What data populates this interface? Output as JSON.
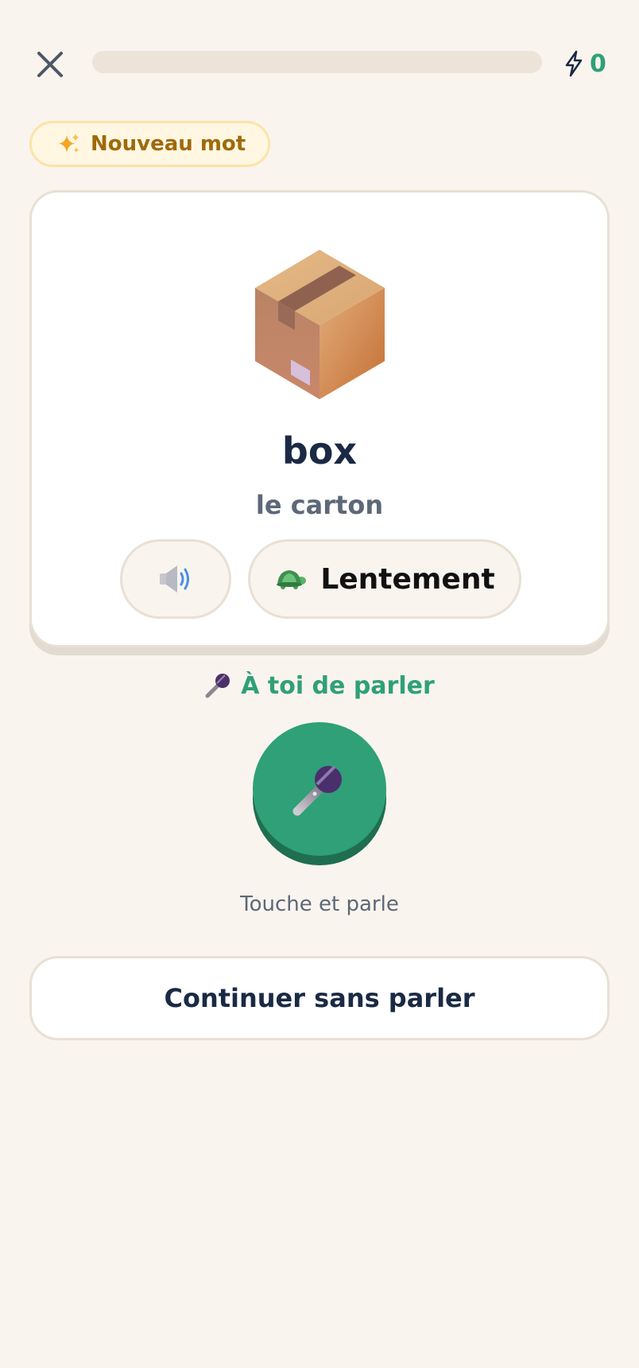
{
  "header": {
    "progress": 0,
    "xp_count": "0",
    "close_icon": "close-icon",
    "xp_icon": "lightning-icon"
  },
  "badge": {
    "label": "Nouveau mot",
    "icon": "sparkles-icon"
  },
  "card": {
    "illustration": "package-box-icon",
    "word": "box",
    "translation": "le carton",
    "sound_icon": "speaker-icon",
    "slow_label": "Lentement",
    "slow_icon": "turtle-icon"
  },
  "speak": {
    "title": "À toi de parler",
    "title_icon": "microphone-icon",
    "hint": "Touche et parle"
  },
  "continue": {
    "label": "Continuer sans parler"
  },
  "colors": {
    "background": "#f9f4ee",
    "accent": "#2fa077",
    "accent_dark": "#206e52",
    "text_dark": "#1b2a44",
    "text_muted": "#5d6878",
    "badge_text": "#a0690a",
    "badge_bg": "#fff7e2",
    "border": "#e8e0d3"
  }
}
